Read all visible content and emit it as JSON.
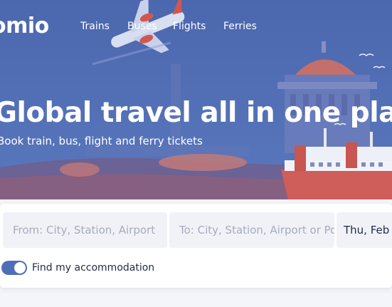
{
  "brand": {
    "logo_text": "omio"
  },
  "nav": {
    "items": [
      {
        "label": "Trains"
      },
      {
        "label": "Buses"
      },
      {
        "label": "Flights"
      },
      {
        "label": "Ferries"
      }
    ]
  },
  "hero": {
    "title": "Global travel all in one place",
    "subtitle": "Book train, bus, flight and ferry tickets"
  },
  "search": {
    "from_placeholder": "From: City, Station, Airport",
    "to_placeholder": "To: City, Station, Airport or Port",
    "date_value": "Thu, Feb",
    "accommodation_label": "Find my accommodation",
    "accommodation_enabled": true
  },
  "colors": {
    "hero_bg": "#4d6db5",
    "toggle_on": "#4e6fb8",
    "text_dark": "#1f2a4a",
    "placeholder": "#a6acbd"
  }
}
